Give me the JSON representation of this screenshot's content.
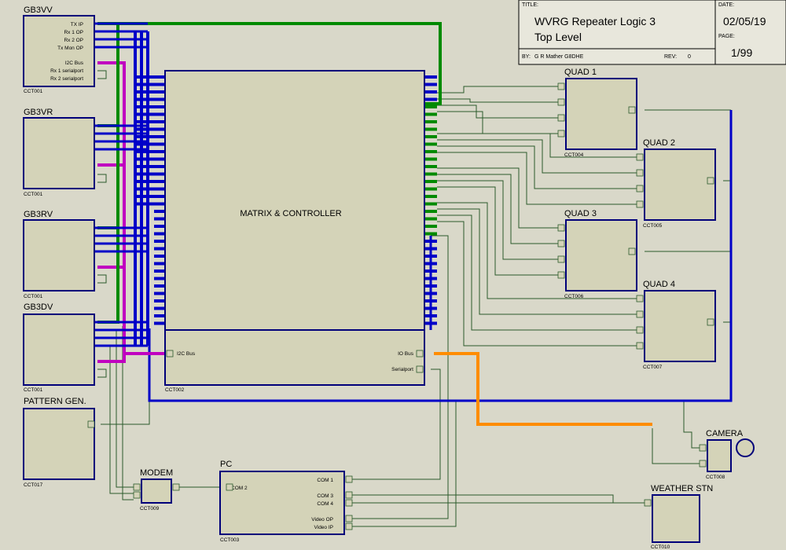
{
  "title_block": {
    "title_label": "TITLE:",
    "title_line1": "WVRG Repeater Logic 3",
    "title_line2": "Top Level",
    "by_label": "BY:",
    "author": "G R Mather G8DHE",
    "rev_label": "REV:",
    "rev": "0",
    "date_label": "DATE:",
    "date": "02/05/19",
    "page_label": "PAGE:",
    "page": "1/99"
  },
  "blocks": {
    "gb3vv": {
      "name": "GB3VV",
      "ref": "CCT001",
      "pins": [
        "TX IP",
        "Rx 1 OP",
        "Rx 2 OP",
        "Tx Mon OP",
        "I2C Bus",
        "Rx 1 serialport",
        "Rx 2 serialport"
      ]
    },
    "gb3vr": {
      "name": "GB3VR",
      "ref": "CCT001"
    },
    "gb3rv": {
      "name": "GB3RV",
      "ref": "CCT001"
    },
    "gb3dv": {
      "name": "GB3DV",
      "ref": "CCT001"
    },
    "pattern": {
      "name": "PATTERN GEN.",
      "ref": "CCT017"
    },
    "matrix": {
      "name": "MATRIX & CONTROLLER",
      "ref": "CCT002",
      "pin_i2c": "I2C Bus",
      "pin_io": "IO Bus",
      "pin_serial": "Serialport"
    },
    "quad1": {
      "name": "QUAD 1",
      "ref": "CCT004"
    },
    "quad2": {
      "name": "QUAD 2",
      "ref": "CCT005"
    },
    "quad3": {
      "name": "QUAD 3",
      "ref": "CCT006"
    },
    "quad4": {
      "name": "QUAD 4",
      "ref": "CCT007"
    },
    "modem": {
      "name": "MODEM",
      "ref": "CCT009"
    },
    "pc": {
      "name": "PC",
      "ref": "CCT003",
      "pins": [
        "COM 2",
        "COM 1",
        "COM 3",
        "COM 4",
        "Video OP",
        "Video IP"
      ]
    },
    "camera": {
      "name": "CAMERA",
      "ref": "CCT008"
    },
    "weather": {
      "name": "WEATHER STN",
      "ref": "CCT010"
    }
  },
  "colors": {
    "background": "#d9d8c9",
    "block_fill": "#d4d3b8",
    "block_border": "#00007a",
    "wire": "#2b5a2b",
    "bus_blue": "#0000c8",
    "bus_green": "#008a00",
    "bus_magenta": "#c000c0",
    "bus_orange": "#ff8c00"
  }
}
